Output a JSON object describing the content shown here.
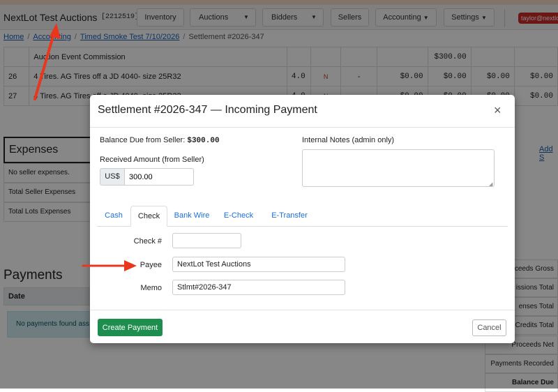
{
  "navbar": {
    "brand": "NextLot Test Auctions",
    "auction_id": "[2212519]",
    "inventory": "Inventory",
    "auctions": "Auctions",
    "bidders": "Bidders",
    "sellers": "Sellers",
    "accounting": "Accounting",
    "settings": "Settings",
    "user": "taylor@nextlot"
  },
  "breadcrumb": {
    "home": "Home",
    "accounting": "Accounting",
    "event": "Timed Smoke Test 7/10/2026",
    "current": "Settlement #2026-347"
  },
  "background": {
    "commission_label": "Auction Event Commission",
    "commission_amount": "$300.00",
    "rows": [
      {
        "lot": "26",
        "desc": "4 Tires. AG Tires off a JD 4040- size 25R32",
        "qty": "4.0",
        "flag": "N",
        "dash": "-",
        "a1": "$0.00",
        "a2": "$0.00",
        "a3": "$0.00",
        "a4": "$0.00"
      },
      {
        "lot": "27",
        "desc": "4 Tires. AG Tires off a JD 4040- size 25R32",
        "qty": "4.0",
        "flag": "N",
        "dash": "-",
        "a1": "$0.00",
        "a2": "$0.00",
        "a3": "$0.00",
        "a4": "$0.00"
      }
    ],
    "expenses_title": "Expenses",
    "add_link": "Add S",
    "no_expenses": "No seller expenses.",
    "total_seller_expenses": "Total Seller Expenses",
    "total_lots_expenses": "Total Lots Expenses",
    "payments_title": "Payments",
    "date_header": "Date",
    "no_payments": "No payments found ass",
    "summary": [
      "roceeds Gross",
      "issions Total",
      "enses Total",
      "Credits Total",
      "Proceeds Net",
      "Payments Recorded",
      "Balance Due"
    ]
  },
  "modal": {
    "title": "Settlement #2026-347 — Incoming Payment",
    "close_symbol": "×",
    "balance_label": "Balance Due from Seller: ",
    "balance_value": "$300.00",
    "received_label": "Received Amount (from Seller)",
    "currency_prefix": "US$",
    "received_value": "300.00",
    "notes_label": "Internal Notes (admin only)",
    "tabs": [
      "Cash",
      "Check",
      "Bank Wire",
      "E-Check",
      "E-Transfer"
    ],
    "active_tab": "Check",
    "check_label": "Check #",
    "check_value": "",
    "payee_label": "Payee",
    "payee_value": "NextLot Test Auctions",
    "memo_label": "Memo",
    "memo_value": "Stlmt#2026-347",
    "create_button": "Create Payment",
    "cancel_button": "Cancel"
  },
  "colors": {
    "primary_green": "#1e8e4e",
    "link_blue": "#1a6fd6",
    "annotation_red": "#e8371c",
    "user_badge": "#cf2a2a"
  }
}
